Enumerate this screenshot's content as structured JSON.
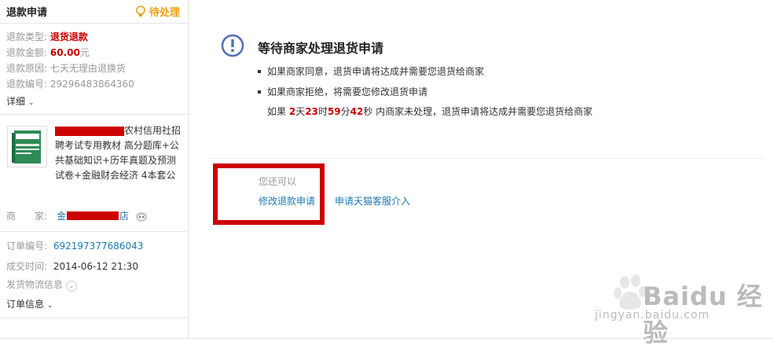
{
  "sidebar": {
    "title": "退款申请",
    "status": "待处理",
    "fields": [
      {
        "key": "退款类型:",
        "value": "退货退款",
        "style": "red"
      },
      {
        "key": "退款金额:",
        "value": "60.00",
        "unit": "元",
        "style": "red"
      },
      {
        "key": "退款原因:",
        "value": "七天无理由退换货",
        "style": "gray"
      },
      {
        "key": "退款编号:",
        "value": "29296483864360",
        "style": "gray"
      }
    ],
    "detail_label": "详细",
    "product_name": "农村信用社招聘考试专用教材 高分题库+公共基础知识+历年真题及预测试卷+金融财会经济 4本套公",
    "shop_key": "商　　家:",
    "shop_prefix": "金",
    "shop_suffix": "店",
    "order": [
      {
        "key": "订单编号:",
        "value": "692197377686043"
      },
      {
        "key": "成交时间:",
        "value": "2014-06-12 21:30"
      }
    ],
    "logistics_label": "发货物流信息",
    "order_info_label": "订单信息"
  },
  "main": {
    "title": "等待商家处理退货申请",
    "bullets": [
      "如果商家同意，退货申请将达成并需要您退货给商家",
      "如果商家拒绝，将需要您修改退货申请"
    ],
    "countdown": {
      "prefix": "如果 ",
      "days": "2",
      "days_unit": "天",
      "hours": "23",
      "hours_unit": "时",
      "minutes": "59",
      "minutes_unit": "分",
      "seconds": "42",
      "seconds_unit": "秒",
      "suffix": " 内商家未处理，退货申请将达成并需要您退货给商家"
    },
    "can_label": "您还可以",
    "actions": [
      "修改退款申请",
      "申请天猫客服介入"
    ]
  },
  "watermark": {
    "text": "Baidu 经验",
    "url": "jingyan.baidu.com"
  },
  "colors": {
    "red": "#cc0000",
    "link": "#1e78b4",
    "status": "#f0a010",
    "info_icon": "#5470b4"
  }
}
